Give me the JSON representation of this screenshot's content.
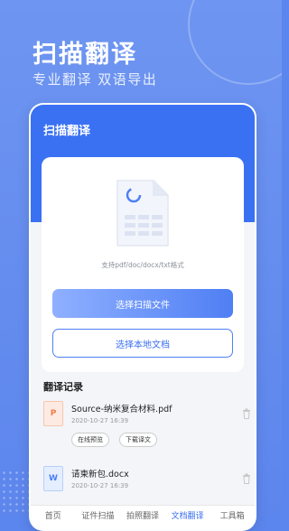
{
  "hero": {
    "title": "扫描翻译",
    "subtitle": "专业翻译 双语导出"
  },
  "phone": {
    "header_title": "扫描翻译",
    "upload": {
      "support_text": "支持pdf/doc/docx/txt格式",
      "primary_button": "选择扫描文件",
      "secondary_button": "选择本地文档"
    },
    "records": {
      "section_title": "翻译记录",
      "items": [
        {
          "badge": "P",
          "name": "Source-纳米复合材料.pdf",
          "time": "2020-10-27 16:39",
          "actions": [
            "在线预览",
            "下载译文"
          ],
          "type": "pdf"
        },
        {
          "badge": "W",
          "name": "请柬新包.docx",
          "time": "2020-10-27 16:39",
          "actions": [],
          "type": "docx"
        }
      ]
    },
    "tabs": [
      {
        "label": "首页",
        "active": false
      },
      {
        "label": "证件扫描",
        "active": false
      },
      {
        "label": "拍照翻译",
        "active": false
      },
      {
        "label": "文档翻译",
        "active": true
      },
      {
        "label": "工具箱",
        "active": false
      }
    ]
  },
  "colors": {
    "accent": "#3a71f3",
    "background": "#6e95f1",
    "pdf": "#f07c47",
    "doc": "#4a7ff0"
  }
}
